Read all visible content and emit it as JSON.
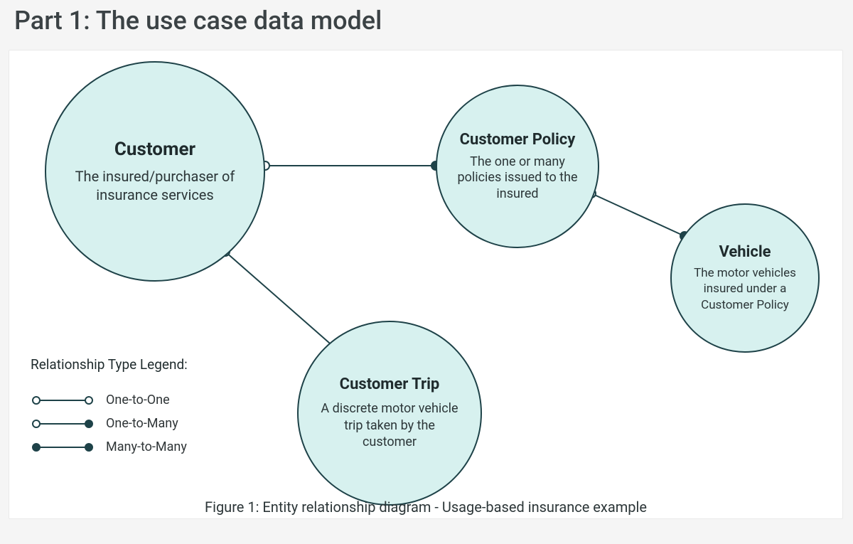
{
  "header": {
    "title": "Part 1: The use case data model"
  },
  "diagram": {
    "entities": {
      "customer": {
        "title": "Customer",
        "description": "The insured/purchaser of insurance services"
      },
      "customer_policy": {
        "title": "Customer Policy",
        "description": "The one or many policies issued to the insured"
      },
      "vehicle": {
        "title": "Vehicle",
        "description": "The motor vehicles insured under a Customer Policy"
      },
      "customer_trip": {
        "title": "Customer Trip",
        "description": "A discrete motor vehicle trip taken by the customer"
      }
    },
    "relationships": [
      {
        "from": "customer",
        "to": "customer_policy",
        "type": "one-to-many"
      },
      {
        "from": "customer",
        "to": "customer_trip",
        "type": "one-to-many"
      },
      {
        "from": "customer_policy",
        "to": "vehicle",
        "type": "one-to-many"
      }
    ]
  },
  "legend": {
    "title": "Relationship Type Legend:",
    "items": [
      {
        "label": "One-to-One",
        "start": "open",
        "end": "open"
      },
      {
        "label": "One-to-Many",
        "start": "open",
        "end": "filled"
      },
      {
        "label": "Many-to-Many",
        "start": "filled",
        "end": "filled"
      }
    ]
  },
  "caption": "Figure 1: Entity relationship diagram - Usage-based insurance example"
}
